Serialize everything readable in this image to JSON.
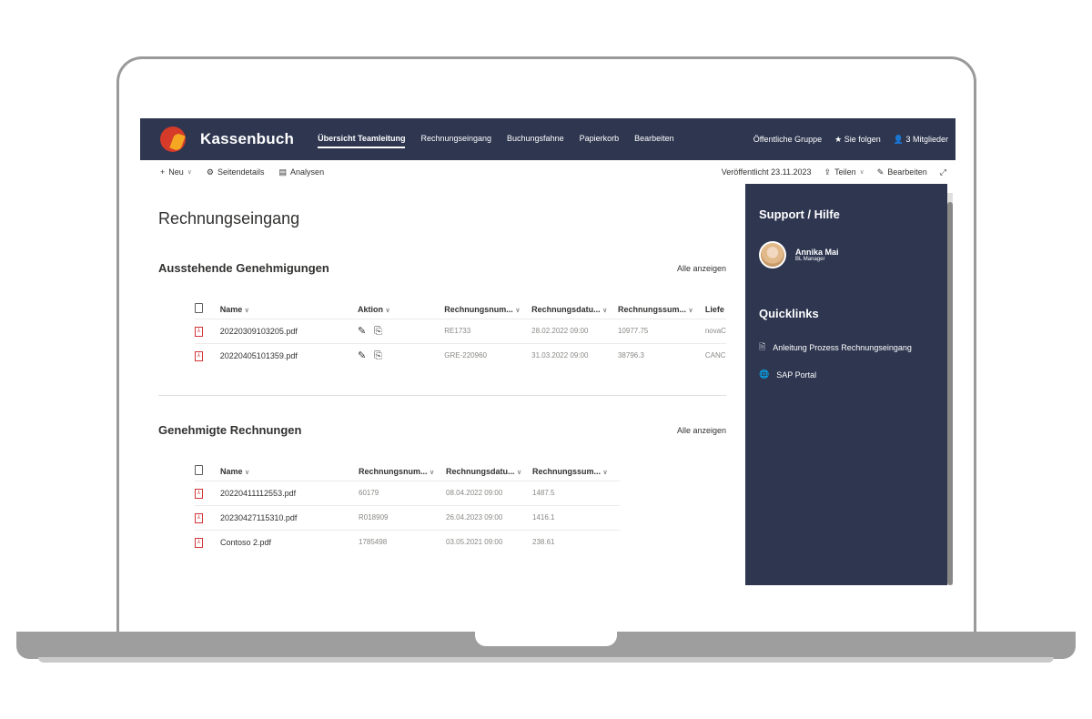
{
  "site": {
    "title": "Kassenbuch",
    "nav": [
      "Übersicht Teamleitung",
      "Rechnungseingang",
      "Buchungsfahne",
      "Papierkorb",
      "Bearbeiten"
    ],
    "right": {
      "group": "Öffentliche Gruppe",
      "follow": "Sie folgen",
      "members": "3 Mitglieder"
    }
  },
  "cmdbar": {
    "new": "Neu",
    "details": "Seitendetails",
    "analytics": "Analysen",
    "published": "Veröffentlicht 23.11.2023",
    "share": "Teilen",
    "edit": "Bearbeiten"
  },
  "page": {
    "title": "Rechnungseingang"
  },
  "pending": {
    "title": "Ausstehende Genehmigungen",
    "show_all": "Alle anzeigen",
    "headers": [
      "Name",
      "Aktion",
      "Rechnungsnum...",
      "Rechnungsdatu...",
      "Rechnungssum...",
      "Liefe"
    ],
    "rows": [
      {
        "name": "20220309103205.pdf",
        "num": "RE1733",
        "date": "28.02.2022 09:00",
        "sum": "10977.75",
        "supplier": "novaC"
      },
      {
        "name": "20220405101359.pdf",
        "num": "GRE-220960",
        "date": "31.03.2022 09:00",
        "sum": "38796.3",
        "supplier": "CANC"
      }
    ]
  },
  "approved": {
    "title": "Genehmigte Rechnungen",
    "show_all": "Alle anzeigen",
    "headers": [
      "Name",
      "Rechnungsnum...",
      "Rechnungsdatu...",
      "Rechnungssum..."
    ],
    "rows": [
      {
        "name": "20220411112553.pdf",
        "num": "60179",
        "date": "08.04.2022 09:00",
        "sum": "1487.5"
      },
      {
        "name": "20230427115310.pdf",
        "num": "R018909",
        "date": "26.04.2023 09:00",
        "sum": "1416.1"
      },
      {
        "name": "Contoso 2.pdf",
        "num": "1785498",
        "date": "03.05.2021 09:00",
        "sum": "238.61"
      }
    ]
  },
  "side": {
    "support_title": "Support / Hilfe",
    "person_name": "Annika Mai",
    "person_role": "BL Manager",
    "quicklinks_title": "Quicklinks",
    "links": [
      "Anleitung Prozess Rechnungseingang",
      "SAP Portal"
    ]
  },
  "colors": {
    "suitebar": "#2e3650",
    "accent_red": "#d63b2a",
    "accent_orange": "#f5a623"
  }
}
